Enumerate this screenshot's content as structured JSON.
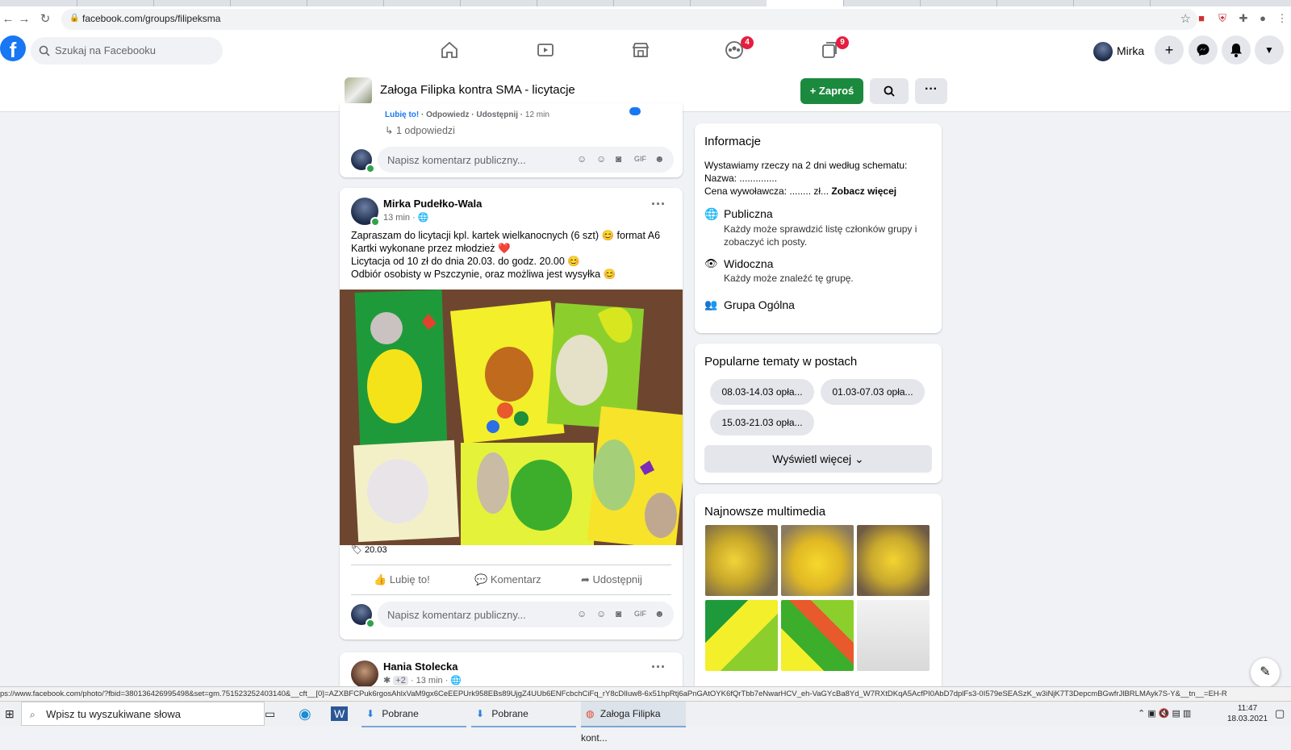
{
  "browser": {
    "url": "facebook.com/groups/filipeksma",
    "status_url": "ps://www.facebook.com/photo/?fbid=380136426995498&set=gm.751523252403140&__cft__[0]=AZXBFCPuk6rgosAhlxVaM9gx6CeEEPUrk958EBs89UjgZ4UUb6ENFcbchCiFq_rY8cDlIuw8-6x51hpRtj6aPnGAtOYK6fQrTbb7eNwarHCV_eh-VaGYcBa8Yd_W7RXtDKqA5AcfPI0AbD7dplFs3-0I579eSEASzK_w3iNjK7T3DepcmBGwfrJlBRLMAyk7S-Y&__tn__=EH-R"
  },
  "fb": {
    "search_placeholder": "Szukaj na Facebooku",
    "groups_badge": "4",
    "notif_badge": "9",
    "user_name": "Mirka"
  },
  "group": {
    "name": "Załoga Filipka kontra SMA - licytacje",
    "invite_label": "+ Zaproś",
    "more_label": "···"
  },
  "prev_post": {
    "like": "Lubię to!",
    "reply": "Odpowiedz",
    "share": "Udostępnij",
    "time": "12 min",
    "replies": "1 odpowiedzi",
    "comment_placeholder": "Napisz komentarz publiczny..."
  },
  "post": {
    "author": "Mirka Pudełko-Wala",
    "time": "13 min",
    "lines": [
      "Zapraszam do licytacji kpl. kartek wielkanocnych (6 szt) 😊 format A6",
      "Kartki wykonane przez młodzież ❤️",
      "Licytacja od 10 zł do dnia 20.03. do godz. 20.00 😊",
      "Odbiór osobisty w Pszczynie, oraz możliwa jest wysyłka 😊"
    ],
    "tag": "20.03",
    "like": "Lubię to!",
    "comment": "Komentarz",
    "share": "Udostępnij",
    "comment_placeholder": "Napisz komentarz publiczny..."
  },
  "next_post": {
    "author": "Hania Stolecka",
    "extra": "+2",
    "time": "13 min"
  },
  "sidebar": {
    "info_title": "Informacje",
    "info_lines": [
      "Wystawiamy rzeczy na 2 dni według schematu:",
      "Nazwa: ..............",
      "Cena wywoławcza: ........ zł..."
    ],
    "see_more": "Zobacz więcej",
    "public_title": "Publiczna",
    "public_desc": "Każdy może sprawdzić listę członków grupy i zobaczyć ich posty.",
    "visible_title": "Widoczna",
    "visible_desc": "Każdy może znaleźć tę grupę.",
    "general": "Grupa Ogólna",
    "topics_title": "Popularne tematy w postach",
    "topics": [
      "08.03-14.03 opła...",
      "01.03-07.03 opła...",
      "15.03-21.03 opła..."
    ],
    "show_more": "Wyświetl więcej",
    "media_title": "Najnowsze multimedia"
  },
  "taskbar": {
    "search": "Wpisz tu wyszukiwane słowa",
    "item1": "Pobrane",
    "item2": "Pobrane",
    "item3": "Załoga Filipka kont...",
    "time": "11:47",
    "date": "18.03.2021"
  },
  "colors": {
    "fb_blue": "#1877f2",
    "invite_green": "#1b8a3e",
    "badge_red": "#e41e3f"
  }
}
